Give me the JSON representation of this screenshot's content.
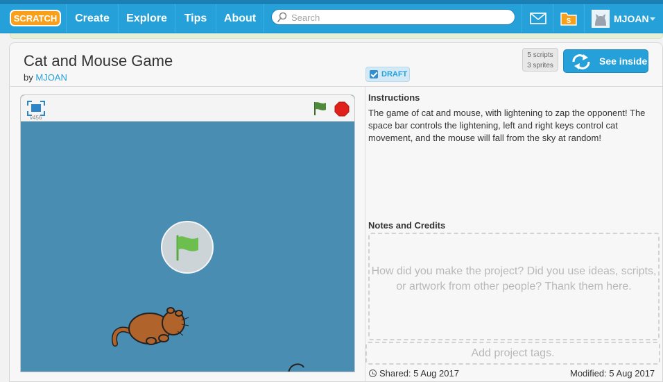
{
  "nav": {
    "logo_text": "SCRATCH",
    "items": [
      "Create",
      "Explore",
      "Tips",
      "About"
    ],
    "search_placeholder": "Search",
    "messages_icon": "envelope-icon",
    "mystuff_icon": "my-stuff-folder-icon",
    "username": "MJOAN"
  },
  "project": {
    "title": "Cat and Mouse Game",
    "by_label": "by",
    "author": "MJOAN",
    "draft_label": "DRAFT",
    "scripts_count": "5 scripts",
    "sprites_count": "3 sprites",
    "see_inside_label": "See inside",
    "version": "v456"
  },
  "instructions": {
    "heading": "Instructions",
    "text": "The game of cat and mouse, with lightening to zap the opponent! The space bar controls the lightening, left and right keys control cat movement, and the mouse will fall from the sky at random!"
  },
  "notes": {
    "heading": "Notes and Credits",
    "placeholder": "How did you make the project? Did you use ideas, scripts, or artwork from other people? Thank them here."
  },
  "tags": {
    "placeholder": "Add project tags."
  },
  "dates": {
    "shared": "Shared: 5 Aug 2017",
    "modified": "Modified: 5 Aug 2017"
  },
  "colors": {
    "nav_blue": "#25a0d8",
    "stage_blue": "#4a8db3",
    "flag_green": "#4caf50",
    "stop_red": "#e0201a"
  }
}
